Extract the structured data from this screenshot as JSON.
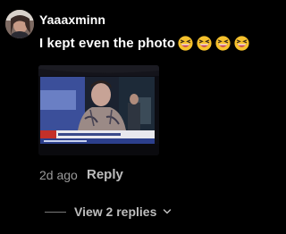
{
  "comment": {
    "username": "Yaaaxminn",
    "text": "I kept even the photo",
    "emojis": [
      "grinning-squinting-face-icon",
      "grinning-squinting-face-icon",
      "grinning-squinting-face-icon",
      "grinning-squinting-face-icon"
    ],
    "timestamp": "2d ago",
    "reply_label": "Reply",
    "view_replies_label": "View 2 replies",
    "avatar_icon": "user-avatar",
    "photo_icon": "attached-photo"
  },
  "colors": {
    "background": "#000000",
    "text_primary": "#ffffff",
    "text_secondary": "#9a9a9a",
    "action_text": "#bdbdbd",
    "emoji_yellow": "#f6c12c",
    "emoji_mouth": "#c8455a"
  }
}
